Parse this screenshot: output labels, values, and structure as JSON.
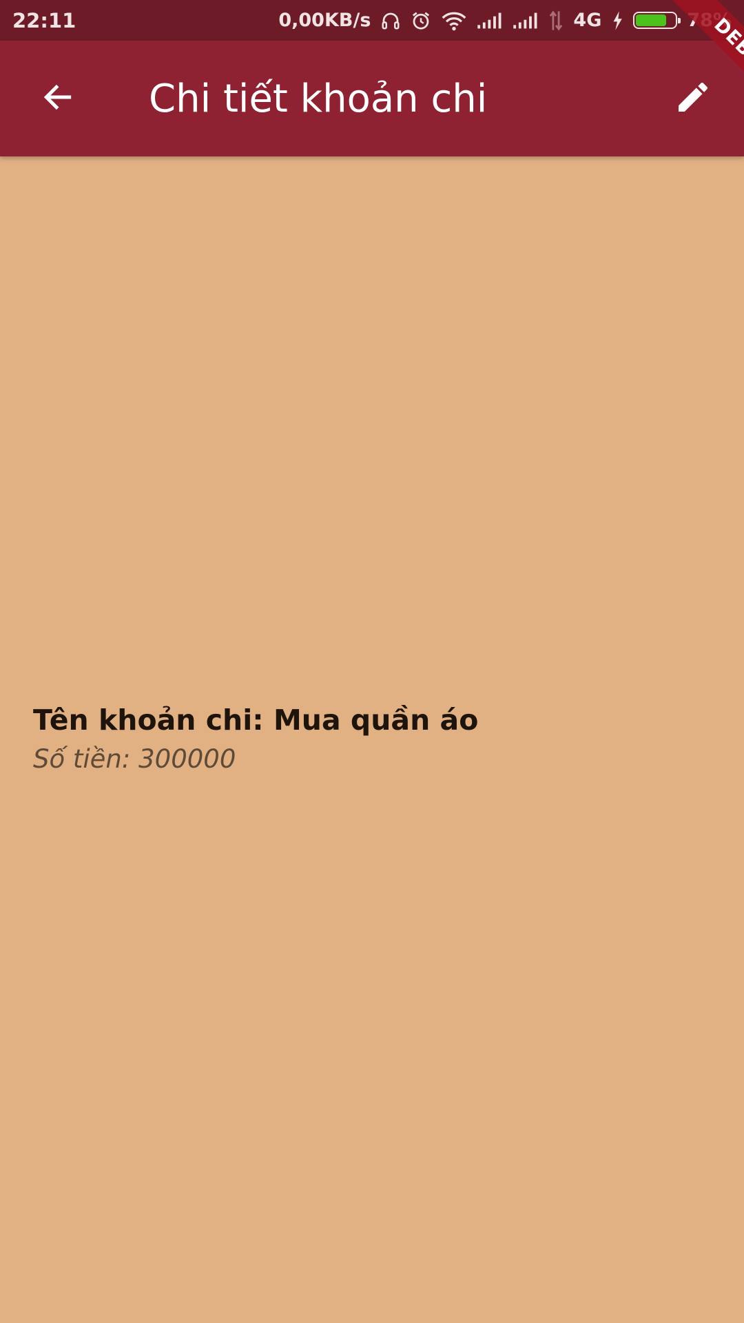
{
  "status_bar": {
    "time": "22:11",
    "network_speed": "0,00KB/s",
    "network_type": "4G",
    "battery_percent": "78%",
    "battery_level": 0.78,
    "icons": [
      "headphones-icon",
      "alarm-icon",
      "wifi-icon",
      "signal-icon",
      "signal-icon",
      "data-arrows-icon",
      "charging-icon",
      "battery-icon"
    ]
  },
  "app_bar": {
    "title": "Chi tiết khoản chi",
    "back_icon": "arrow-back-icon",
    "edit_icon": "pencil-icon",
    "background_color": "#8E2233"
  },
  "debug_banner": {
    "label": "DEBUG"
  },
  "detail": {
    "name_line": "Tên khoản chi: Mua quần áo",
    "amount_line": "Số tiền: 300000"
  },
  "colors": {
    "page_background": "#E1B184",
    "status_bar": "#6E1B28",
    "battery_fill": "#4CC21C"
  }
}
